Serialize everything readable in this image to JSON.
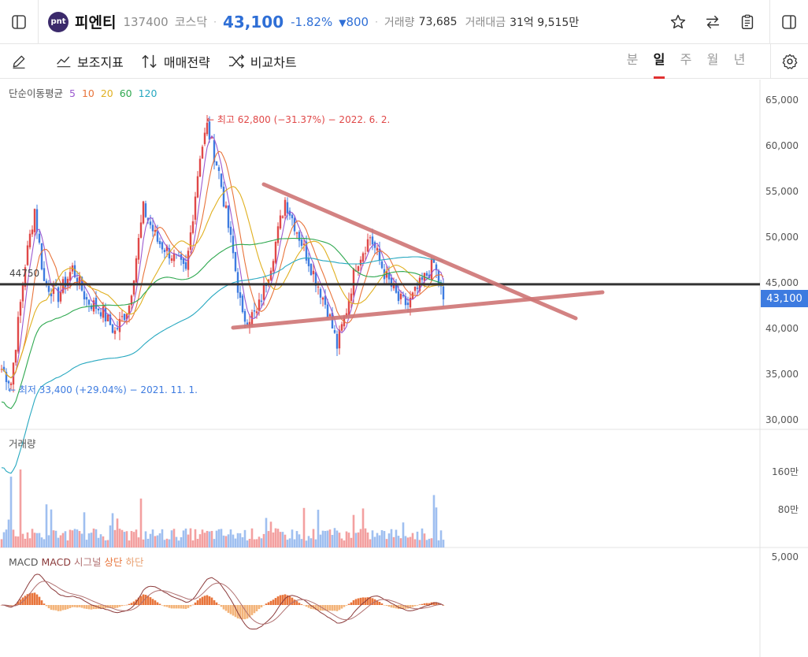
{
  "header": {
    "name": "피엔티",
    "code": "137400",
    "market": "코스닥",
    "price": "43,100",
    "change_pct": "-1.82%",
    "change_abs": "800",
    "volume_label": "거래량",
    "volume_value": "73,685",
    "amount_label": "거래대금",
    "amount_value": "31억 9,515만",
    "logo_text": "pnt"
  },
  "toolbar": {
    "indicator_label": "보조지표",
    "strategy_label": "매매전략",
    "compare_label": "비교차트",
    "periods": [
      "분",
      "일",
      "주",
      "월",
      "년"
    ],
    "active_period": "일"
  },
  "legend": {
    "ma_title": "단순이동평균",
    "ma_periods": [
      "5",
      "10",
      "20",
      "60",
      "120"
    ],
    "ma_colors": [
      "#9b59d0",
      "#e8743b",
      "#e0b020",
      "#2ea84f",
      "#27a8c0"
    ],
    "volume_title": "거래량",
    "macd_items": [
      "MACD",
      "MACD",
      "시그널",
      "상단",
      "하단"
    ],
    "macd_colors": [
      "#555555",
      "#8b3a3a",
      "#b07070",
      "#e8743b",
      "#e8a070"
    ]
  },
  "annotations": {
    "high_note": "최고 62,800 (−31.37%) − 2022. 6. 2.",
    "low_note": "최저 33,400 (+29.04%) − 2021. 11. 1.",
    "level_tag": "44750",
    "current_price_tag": "43,100"
  },
  "axes": {
    "price_ticks": [
      "65,000",
      "60,000",
      "55,000",
      "50,000",
      "45,000",
      "40,000",
      "35,000",
      "30,000"
    ],
    "volume_ticks": [
      "160만",
      "80만"
    ],
    "macd_ticks": [
      "5,000"
    ]
  },
  "colors": {
    "up": "#e04848",
    "down": "#3d7be0",
    "trendline": "#cf7575",
    "level_line": "#333333"
  },
  "chart_data": {
    "type": "candlestick",
    "price_range": [
      30000,
      65000
    ],
    "horizontal_level": 44750,
    "high": {
      "value": 62800,
      "date": "2022. 6. 2."
    },
    "low": {
      "value": 33400,
      "date": "2021. 11. 1."
    },
    "current": 43100,
    "price_keypoints": [
      {
        "i": 0,
        "p": 35500
      },
      {
        "i": 4,
        "p": 34000
      },
      {
        "i": 10,
        "p": 47000
      },
      {
        "i": 14,
        "p": 53000
      },
      {
        "i": 18,
        "p": 45000
      },
      {
        "i": 24,
        "p": 43500
      },
      {
        "i": 30,
        "p": 46500
      },
      {
        "i": 36,
        "p": 43000
      },
      {
        "i": 42,
        "p": 42000
      },
      {
        "i": 48,
        "p": 39500
      },
      {
        "i": 54,
        "p": 42500
      },
      {
        "i": 60,
        "p": 53000
      },
      {
        "i": 66,
        "p": 49500
      },
      {
        "i": 72,
        "p": 48000
      },
      {
        "i": 78,
        "p": 46000
      },
      {
        "i": 84,
        "p": 59000
      },
      {
        "i": 87,
        "p": 62000
      },
      {
        "i": 92,
        "p": 57000
      },
      {
        "i": 98,
        "p": 48000
      },
      {
        "i": 102,
        "p": 41000
      },
      {
        "i": 108,
        "p": 41500
      },
      {
        "i": 114,
        "p": 47000
      },
      {
        "i": 120,
        "p": 54000
      },
      {
        "i": 126,
        "p": 50000
      },
      {
        "i": 132,
        "p": 46000
      },
      {
        "i": 138,
        "p": 42000
      },
      {
        "i": 142,
        "p": 38000
      },
      {
        "i": 146,
        "p": 42000
      },
      {
        "i": 150,
        "p": 47000
      },
      {
        "i": 156,
        "p": 50000
      },
      {
        "i": 162,
        "p": 46000
      },
      {
        "i": 168,
        "p": 43000
      },
      {
        "i": 172,
        "p": 42500
      },
      {
        "i": 178,
        "p": 45000
      },
      {
        "i": 183,
        "p": 47000
      },
      {
        "i": 187,
        "p": 43100
      }
    ],
    "volume_range": [
      0,
      200
    ],
    "macd_range": [
      -9000,
      7000
    ]
  }
}
